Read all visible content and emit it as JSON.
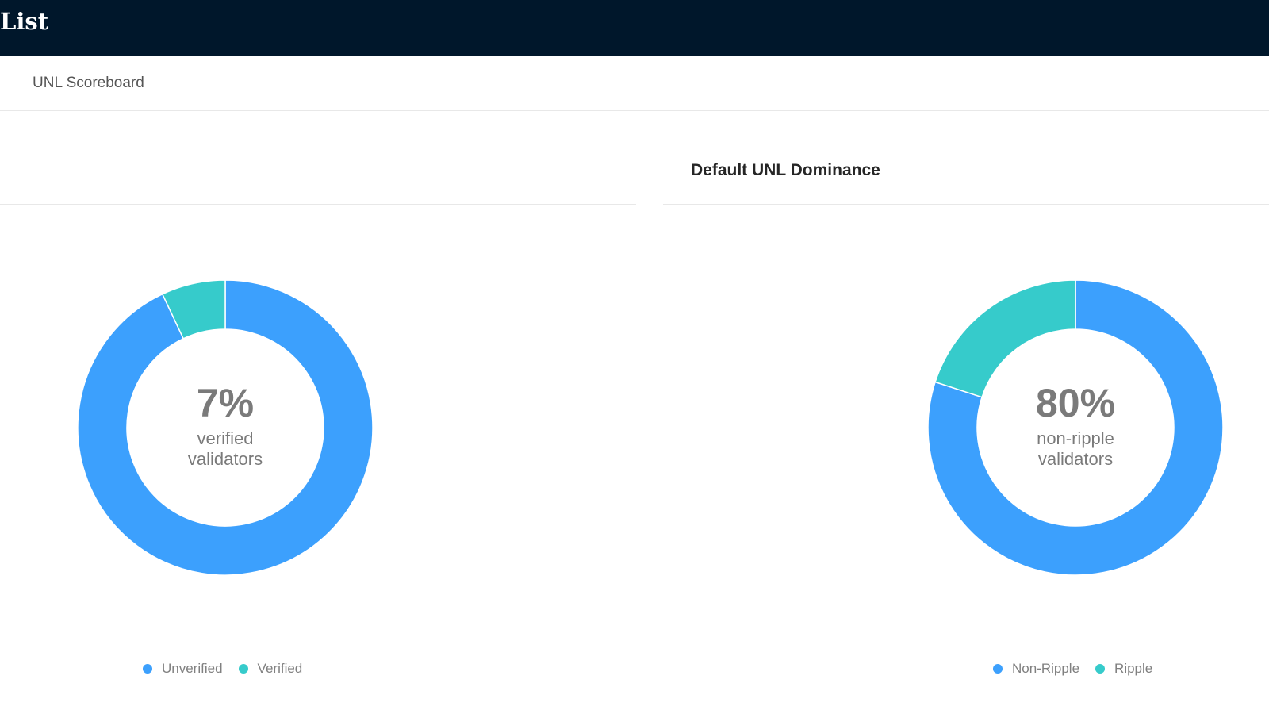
{
  "header": {
    "title": "List"
  },
  "subnav": {
    "items": [
      {
        "label": "UNL Scoreboard"
      }
    ]
  },
  "charts": {
    "left": {
      "title": "",
      "center_value": "7%",
      "center_caption": "verified validators"
    },
    "right": {
      "title": "Default UNL Dominance",
      "center_value": "80%",
      "center_caption": "non-ripple validators"
    }
  },
  "chart_data": [
    {
      "type": "pie",
      "title": "",
      "categories": [
        "Unverified",
        "Verified"
      ],
      "values": [
        93,
        7
      ],
      "colors": [
        "#3ca0fd",
        "#36cbcb"
      ],
      "legend": "bottom-center"
    },
    {
      "type": "pie",
      "title": "Default UNL Dominance",
      "categories": [
        "Non-Ripple",
        "Ripple"
      ],
      "values": [
        80,
        20
      ],
      "colors": [
        "#3ca0fd",
        "#36cbcb"
      ],
      "legend": "bottom-center"
    }
  ]
}
